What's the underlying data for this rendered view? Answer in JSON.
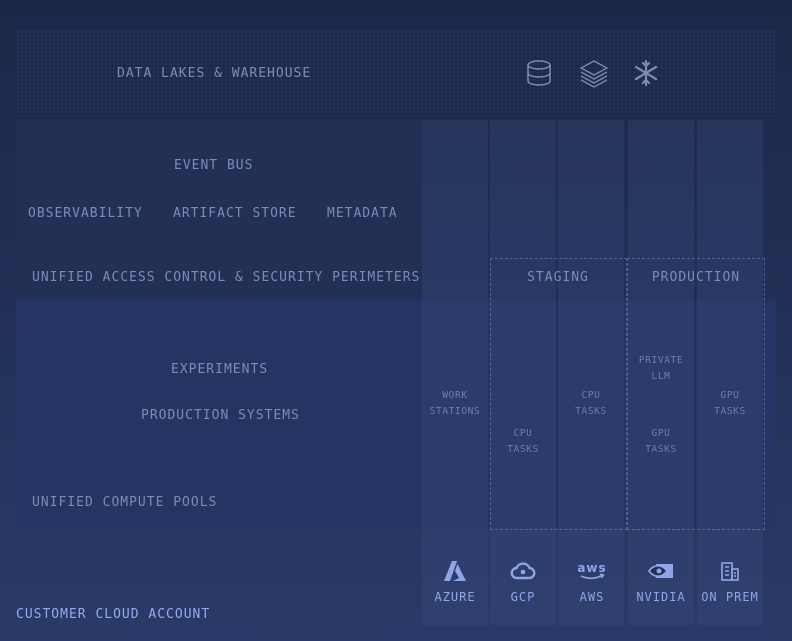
{
  "layers": {
    "data_lakes": "DATA LAKES & WAREHOUSE",
    "event_bus": "EVENT BUS",
    "observability": "OBSERVABILITY",
    "artifact_store": "ARTIFACT STORE",
    "metadata": "METADATA",
    "access_control": "UNIFIED ACCESS CONTROL & SECURITY PERIMETERS",
    "experiments": "EXPERIMENTS",
    "production_systems": "PRODUCTION SYSTEMS",
    "compute_pools": "UNIFIED COMPUTE POOLS"
  },
  "data_icons": [
    "database-icon",
    "layers-icon",
    "snowflake-icon"
  ],
  "environments": {
    "staging": "STAGING",
    "production": "PRODUCTION"
  },
  "tasks": {
    "workstations": [
      "WORK",
      "STATIONS"
    ],
    "staging_cpu_1": [
      "CPU",
      "TASKS"
    ],
    "staging_cpu_2": [
      "CPU",
      "TASKS"
    ],
    "private_llm": [
      "PRIVATE",
      "LLM"
    ],
    "prod_gpu_1": [
      "GPU",
      "TASKS"
    ],
    "prod_gpu_2": [
      "GPU",
      "TASKS"
    ]
  },
  "providers": [
    {
      "label": "AZURE",
      "icon": "azure-icon"
    },
    {
      "label": "GCP",
      "icon": "gcp-cloud-icon"
    },
    {
      "label": "AWS",
      "icon": "aws-icon"
    },
    {
      "label": "NVIDIA",
      "icon": "nvidia-icon"
    },
    {
      "label": "ON PREM",
      "icon": "building-icon"
    }
  ],
  "account_label": "CUSTOMER CLOUD ACCOUNT",
  "colors": {
    "background": "#223057",
    "label": "#7c8bb3",
    "accent": "#8fa6e6"
  }
}
